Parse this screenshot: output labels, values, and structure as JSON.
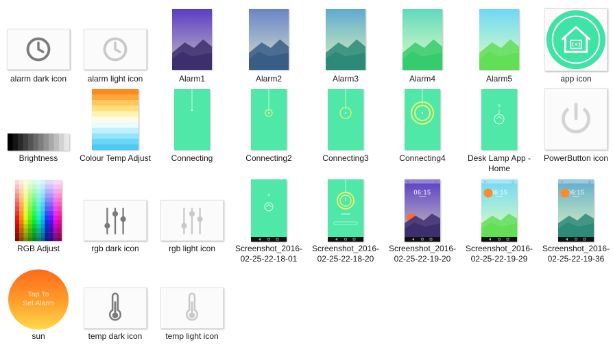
{
  "files": [
    {
      "id": "alarm_dark_icon",
      "label": "alarm dark icon",
      "icon": "clock-icon",
      "tint": "#7b7b7b"
    },
    {
      "id": "alarm_light_icon",
      "label": "alarm light icon",
      "icon": "clock-icon",
      "tint": "#c9c9c9"
    },
    {
      "id": "alarm1",
      "label": "Alarm1",
      "icon": "mountain-gradient-image",
      "sky": [
        "#5a3dc4",
        "#8f7ec4",
        "#c6bdb6"
      ],
      "hill": "#3d2f6e"
    },
    {
      "id": "alarm2",
      "label": "Alarm2",
      "icon": "mountain-gradient-image",
      "sky": [
        "#6a85c7",
        "#9fb3c9",
        "#e4dcc8"
      ],
      "hill": "#385d86"
    },
    {
      "id": "alarm3",
      "label": "Alarm3",
      "icon": "mountain-gradient-image",
      "sky": [
        "#5faad0",
        "#9fd1c3",
        "#d9ecc4"
      ],
      "hill": "#2d8a78"
    },
    {
      "id": "alarm4",
      "label": "Alarm4",
      "icon": "mountain-gradient-image",
      "sky": [
        "#5fd9c0",
        "#a4ecc0",
        "#def9c2"
      ],
      "hill": "#36cb6e"
    },
    {
      "id": "alarm5",
      "label": "Alarm5",
      "icon": "mountain-gradient-image",
      "sky": [
        "#6fd7f7",
        "#a8ecd9",
        "#e6f9c4"
      ],
      "hill": "#62de57"
    },
    {
      "id": "app_icon",
      "label": "app icon",
      "icon": "smart-home-icon",
      "fill": "#3fe3a6"
    },
    {
      "id": "brightness",
      "label": "Brightness",
      "icon": "brightness-gradient-image"
    },
    {
      "id": "colour_temp_adjust",
      "label": "Colour Temp Adjust",
      "icon": "colour-temp-gradient-image"
    },
    {
      "id": "connecting",
      "label": "Connecting",
      "icon": "connecting-screen-image",
      "stage": 0
    },
    {
      "id": "connecting2",
      "label": "Connecting2",
      "icon": "connecting-screen-image",
      "stage": 1
    },
    {
      "id": "connecting3",
      "label": "Connecting3",
      "icon": "connecting-screen-image",
      "stage": 2
    },
    {
      "id": "connecting4",
      "label": "Connecting4",
      "icon": "connecting-screen-image",
      "stage": 3
    },
    {
      "id": "desk_lamp_home",
      "label": "Desk Lamp App - Home",
      "icon": "lamp-home-screen-image"
    },
    {
      "id": "powerbutton_icon",
      "label": "PowerButton icon",
      "icon": "power-icon",
      "tint": "#d4d4d4"
    },
    {
      "id": "rgb_adjust",
      "label": "RGB Adjust",
      "icon": "rgb-grid-image"
    },
    {
      "id": "rgb_dark_icon",
      "label": "rgb dark icon",
      "icon": "sliders-icon",
      "tint": "#7b7b7b"
    },
    {
      "id": "rgb_light_icon",
      "label": "rgb light icon",
      "icon": "sliders-icon",
      "tint": "#c9c9c9"
    },
    {
      "id": "screenshot_180111",
      "label": "Screenshot_2016-02-25-22-18-01",
      "icon": "phone-screenshot-image",
      "variant": "home"
    },
    {
      "id": "screenshot_1820",
      "label": "Screenshot_2016-02-25-22-18-20",
      "icon": "phone-screenshot-image",
      "variant": "ring"
    },
    {
      "id": "screenshot_1920",
      "label": "Screenshot_2016-02-25-22-19-20",
      "icon": "phone-screenshot-image",
      "variant": "alarm",
      "time": "06:15",
      "sky": [
        "#5a3dc4",
        "#8f7ec4",
        "#c6bdb6"
      ],
      "hill": "#3d2f6e",
      "sun": "#ff6a2a"
    },
    {
      "id": "screenshot_1929",
      "label": "Screenshot_2016-02-25-22-19-29",
      "icon": "phone-screenshot-image",
      "variant": "alarm",
      "time": "06:15",
      "sky": [
        "#6fd7f7",
        "#a8ecd9",
        "#e6f9c4"
      ],
      "hill": "#62de57",
      "sun": "#ff8a2a"
    },
    {
      "id": "screenshot_1936",
      "label": "Screenshot_2016-02-25-22-19-36",
      "icon": "phone-screenshot-image",
      "variant": "alarm",
      "time": "06:15",
      "sky": [
        "#5faad0",
        "#9fd1c3",
        "#d9ecc4"
      ],
      "hill": "#2d8a78",
      "sun": "#ff8a2a"
    },
    {
      "id": "sun",
      "label": "sun",
      "icon": "sun-button-image",
      "text": "Tap To Set Alarm"
    },
    {
      "id": "temp_dark_icon",
      "label": "temp dark icon",
      "icon": "thermometer-icon",
      "tint": "#7b7b7b"
    },
    {
      "id": "temp_light_icon",
      "label": "temp light icon",
      "icon": "thermometer-icon",
      "tint": "#c9c9c9"
    }
  ]
}
